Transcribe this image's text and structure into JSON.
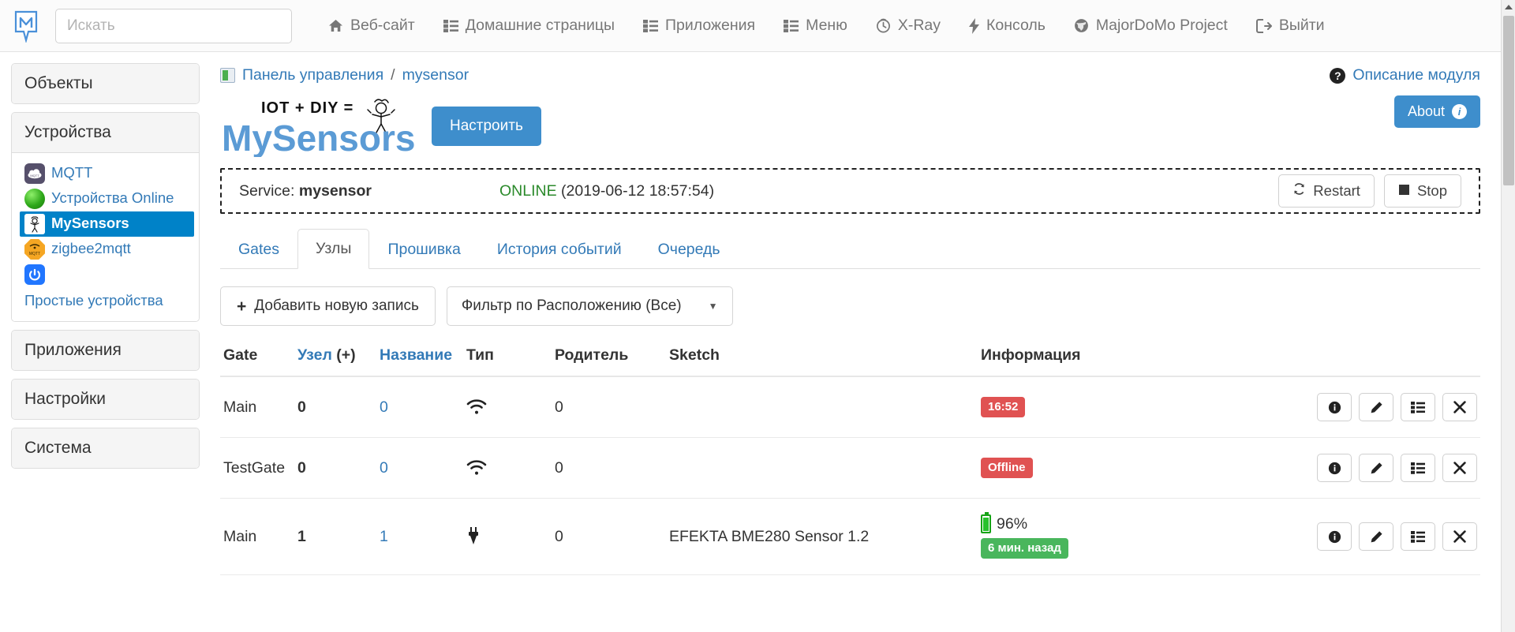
{
  "navbar": {
    "logo_alt": "MajorDoMo logo",
    "search": {
      "placeholder": "Искать",
      "value": ""
    },
    "items": [
      {
        "label": "Веб-сайт",
        "icon": "home-icon"
      },
      {
        "label": "Домашние страницы",
        "icon": "list-icon"
      },
      {
        "label": "Приложения",
        "icon": "list-icon"
      },
      {
        "label": "Меню",
        "icon": "list-icon"
      },
      {
        "label": "X-Ray",
        "icon": "clock-icon"
      },
      {
        "label": "Консоль",
        "icon": "bolt-icon"
      },
      {
        "label": "MajorDoMo Project",
        "icon": "globe-icon"
      },
      {
        "label": "Выйти",
        "icon": "logout-icon"
      }
    ]
  },
  "sidebar": {
    "panels": [
      {
        "title": "Объекты"
      },
      {
        "title": "Устройства"
      },
      {
        "title": "Приложения"
      },
      {
        "title": "Настройки"
      },
      {
        "title": "Система"
      }
    ],
    "devices": [
      {
        "label": "MQTT",
        "icon": "mqtt-icon",
        "active": false
      },
      {
        "label": "Устройства Online",
        "icon": "green-ball-icon",
        "active": false
      },
      {
        "label": "MySensors",
        "icon": "mysensors-icon",
        "active": true
      },
      {
        "label": "zigbee2mqtt",
        "icon": "zigbee-icon",
        "active": false
      },
      {
        "label": "Простые устройства",
        "icon": "power-icon",
        "active": false
      }
    ]
  },
  "breadcrumb": {
    "icon": "dashboard-icon",
    "root": "Панель управления",
    "separator": "/",
    "current": "mysensor"
  },
  "help": {
    "label": "Описание модуля",
    "badge": "?"
  },
  "module": {
    "logo_line1": "IOT + DIY =",
    "logo_line2": "MySensors",
    "configure_button": "Настроить",
    "about_button": "About",
    "about_icon": "i"
  },
  "service": {
    "label": "Service:",
    "name": "mysensor",
    "state": "ONLINE",
    "timestamp": "(2019-06-12 18:57:54)",
    "restart_button": "Restart",
    "stop_button": "Stop"
  },
  "tabs": [
    {
      "label": "Gates",
      "active": false
    },
    {
      "label": "Узлы",
      "active": true
    },
    {
      "label": "Прошивка",
      "active": false
    },
    {
      "label": "История событий",
      "active": false
    },
    {
      "label": "Очередь",
      "active": false
    }
  ],
  "toolbar": {
    "add_button": "Добавить новую запись",
    "add_icon": "+",
    "filter_select": "Фильтр по Расположению (Все)",
    "filter_caret": "▼"
  },
  "table": {
    "headers": {
      "gate": "Gate",
      "node_link": "Узел",
      "node_plus": "(+)",
      "name": "Название",
      "type": "Тип",
      "parent": "Родитель",
      "sketch": "Sketch",
      "info": "Информация"
    },
    "rows": [
      {
        "gate": "Main",
        "node": "0",
        "name": "0",
        "type_icon": "wifi-icon",
        "parent": "0",
        "sketch": "",
        "info": {
          "badge": "16:52",
          "badge_color": "red",
          "battery": null,
          "sub_badge": null
        }
      },
      {
        "gate": "TestGate",
        "node": "0",
        "name": "0",
        "type_icon": "wifi-icon",
        "parent": "0",
        "sketch": "",
        "info": {
          "badge": "Offline",
          "badge_color": "red",
          "battery": null,
          "sub_badge": null
        }
      },
      {
        "gate": "Main",
        "node": "1",
        "name": "1",
        "type_icon": "plug-icon",
        "parent": "0",
        "sketch": "EFEKTA BME280 Sensor  1.2",
        "info": {
          "badge": null,
          "battery": "96%",
          "sub_badge": "6 мин. назад",
          "sub_badge_color": "green"
        }
      }
    ],
    "actions": [
      {
        "name": "info-button",
        "icon": "info-icon"
      },
      {
        "name": "edit-button",
        "icon": "pencil-icon"
      },
      {
        "name": "list-button",
        "icon": "list-icon"
      },
      {
        "name": "delete-button",
        "icon": "close-icon"
      }
    ]
  },
  "colors": {
    "accent": "#337ab7",
    "primary_button": "#3e8ecc",
    "active_sidebar": "#0082c8",
    "online_green": "#2b8a2b",
    "badge_red": "#e05252",
    "badge_green": "#49b65c"
  }
}
